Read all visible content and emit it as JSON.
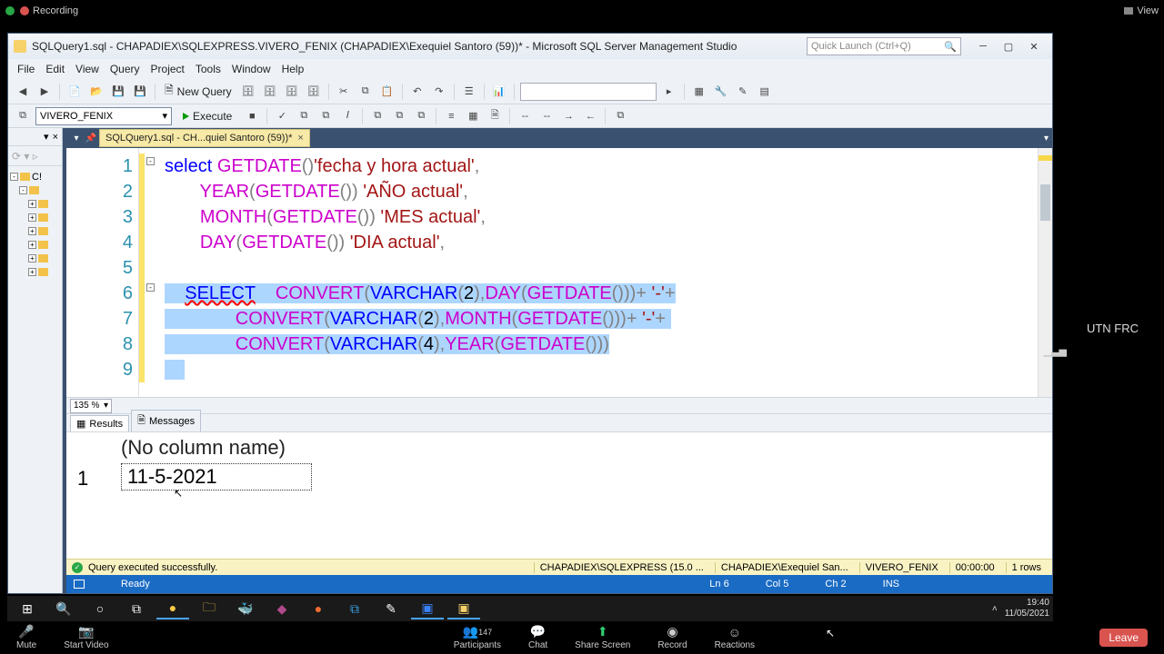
{
  "zoom": {
    "recording": "Recording",
    "view": "View",
    "mute": "Mute",
    "start_video": "Start Video",
    "participants": "Participants",
    "participants_count": "147",
    "chat": "Chat",
    "share": "Share Screen",
    "record": "Record",
    "reactions": "Reactions",
    "leave": "Leave"
  },
  "title": "SQLQuery1.sql - CHAPADIEX\\SQLEXPRESS.VIVERO_FENIX (CHAPADIEX\\Exequiel Santoro (59))* - Microsoft SQL Server Management Studio",
  "quick_launch": "Quick Launch (Ctrl+Q)",
  "menu": {
    "file": "File",
    "edit": "Edit",
    "view": "View",
    "query": "Query",
    "project": "Project",
    "tools": "Tools",
    "window": "Window",
    "help": "Help"
  },
  "toolbar": {
    "new_query": "New Query"
  },
  "db_selected": "VIVERO_FENIX",
  "execute": "Execute",
  "tab_label": "SQLQuery1.sql - CH...quiel Santoro (59))*",
  "object_explorer_top": "C!",
  "gutter": [
    "1",
    "2",
    "3",
    "4",
    "5",
    "6",
    "7",
    "8",
    "9"
  ],
  "code": {
    "l1_select": "select",
    "l1_getdate": "GETDATE",
    "l1_str": "'fecha y hora actual'",
    "l2_year": "YEAR",
    "l2_getdate": "GETDATE",
    "l2_str": "'AÑO actual'",
    "l3_month": "MONTH",
    "l3_getdate": "GETDATE",
    "l3_str": "'MES actual'",
    "l4_day": "DAY",
    "l4_getdate": "GETDATE",
    "l4_str": "'DIA actual'",
    "l6_select": "SELECT",
    "convert": "CONVERT",
    "varchar": "VARCHAR",
    "n2": "2",
    "n4": "4",
    "day": "DAY",
    "month": "MONTH",
    "year": "YEAR",
    "getdate": "GETDATE",
    "dash": "'-'"
  },
  "zoom_pct": "135 %",
  "results": {
    "tab_results": "Results",
    "tab_messages": "Messages",
    "col0": "(No column name)",
    "row1_num": "1",
    "row1_val": "11-5-2021"
  },
  "exec_status": {
    "msg": "Query executed successfully.",
    "server": "CHAPADIEX\\SQLEXPRESS (15.0 ...",
    "user": "CHAPADIEX\\Exequiel San...",
    "db": "VIVERO_FENIX",
    "time": "00:00:00",
    "rows": "1 rows"
  },
  "bluebar": {
    "ready": "Ready",
    "ln": "Ln 6",
    "col": "Col 5",
    "ch": "Ch 2",
    "ins": "INS"
  },
  "utn": "UTN FRC",
  "tray": {
    "time": "19:40",
    "date": "11/05/2021"
  }
}
